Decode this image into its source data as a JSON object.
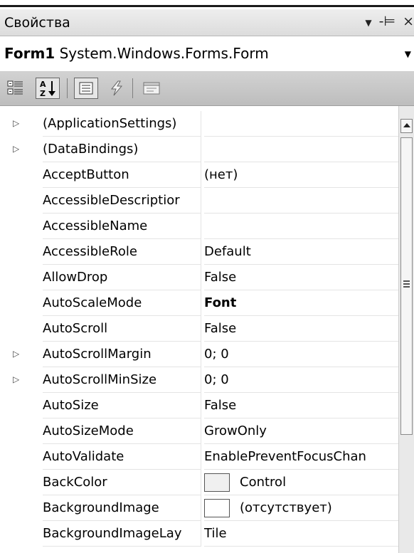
{
  "window": {
    "title": "Свойства",
    "pin_glyph": "▼",
    "dock_glyph": "-⊨",
    "close_glyph": "×"
  },
  "object_selector": {
    "name": "Form1",
    "type": "System.Windows.Forms.Form",
    "arrow": "▼"
  },
  "toolbar": {
    "buttons": [
      "categorized-icon",
      "alphabetical-icon",
      "properties-icon",
      "events-icon",
      "property-pages-icon"
    ]
  },
  "properties": [
    {
      "name": "(ApplicationSettings)",
      "value": "",
      "expandable": true
    },
    {
      "name": "(DataBindings)",
      "value": "",
      "expandable": true
    },
    {
      "name": "AcceptButton",
      "value": "(нет)"
    },
    {
      "name": "AccessibleDescription",
      "display": "AccessibleDescriptior",
      "value": ""
    },
    {
      "name": "AccessibleName",
      "value": ""
    },
    {
      "name": "AccessibleRole",
      "value": "Default"
    },
    {
      "name": "AllowDrop",
      "value": "False"
    },
    {
      "name": "AutoScaleMode",
      "value": "Font",
      "bold": true
    },
    {
      "name": "AutoScroll",
      "value": "False"
    },
    {
      "name": "AutoScrollMargin",
      "value": "0; 0",
      "expandable": true
    },
    {
      "name": "AutoScrollMinSize",
      "value": "0; 0",
      "expandable": true
    },
    {
      "name": "AutoSize",
      "value": "False"
    },
    {
      "name": "AutoSizeMode",
      "value": "GrowOnly"
    },
    {
      "name": "AutoValidate",
      "value": "EnablePreventFocusChan"
    },
    {
      "name": "BackColor",
      "value": "Control",
      "swatch": "#f0f0f0"
    },
    {
      "name": "BackgroundImage",
      "value": "(отсутствует)",
      "swatch": "#ffffff"
    },
    {
      "name": "BackgroundImageLayout",
      "display": "BackgroundImageLay",
      "value": "Tile"
    }
  ]
}
